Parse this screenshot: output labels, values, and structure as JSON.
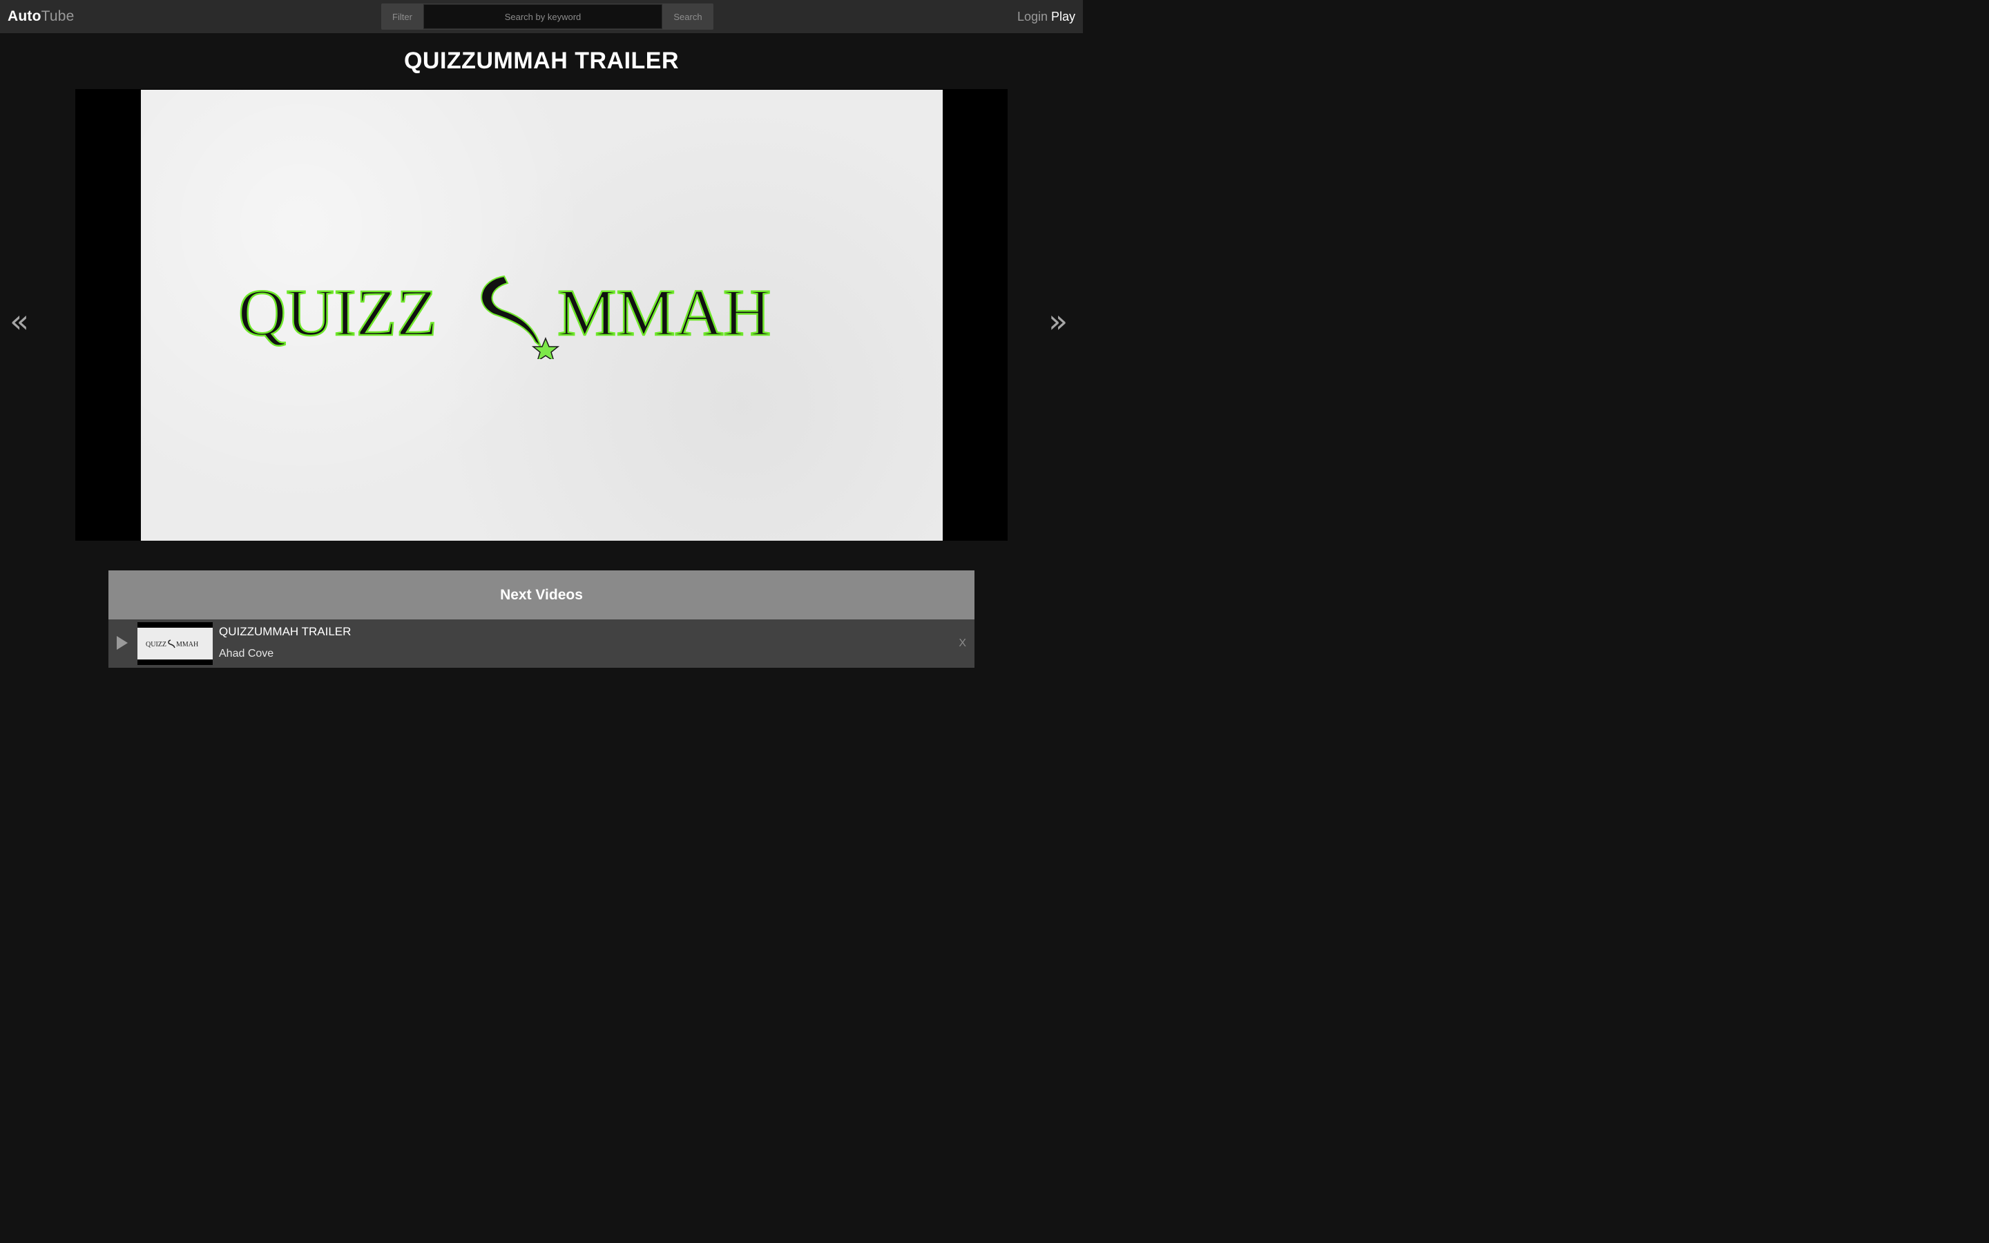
{
  "header": {
    "logo_primary": "Auto",
    "logo_secondary": "Tube",
    "filter_label": "Filter",
    "search_placeholder": "Search by keyword",
    "search_value": "",
    "search_label": "Search",
    "login_label": "Login",
    "play_label": "Play"
  },
  "video": {
    "title": "QUIZZUMMAH TRAILER",
    "logo_text_left": "QUIZZ",
    "logo_text_right": "MMAH",
    "logo_text_color": "#111111",
    "logo_outline_color": "#6fe82a"
  },
  "navigation": {
    "prev_label": "«",
    "next_label": "»"
  },
  "next_videos": {
    "heading": "Next Videos",
    "items": [
      {
        "title": "QUIZZUMMAH TRAILER",
        "author": "Ahad Cove",
        "thumb_text_left": "QUIZZ",
        "thumb_text_right": "MMAH",
        "close_label": "X"
      }
    ]
  },
  "colors": {
    "background": "#121212",
    "topbar": "#2b2b2b",
    "panel_header": "#8a8a8a",
    "panel_item": "#424242"
  }
}
